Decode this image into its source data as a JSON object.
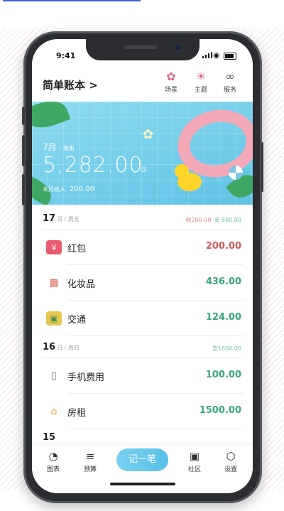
{
  "status": {
    "time": "9:41"
  },
  "header": {
    "title": "简单账本 >",
    "actions": [
      {
        "label": "场景",
        "icon": "scene-icon"
      },
      {
        "label": "主题",
        "icon": "theme-icon"
      },
      {
        "label": "服务",
        "icon": "service-icon"
      }
    ]
  },
  "banner": {
    "month": "7月",
    "month_sub": "· 支出",
    "expense": "5,282.00",
    "income_label": "本月收入",
    "income_value": "200.00"
  },
  "days": [
    {
      "date": "17",
      "weekday": "日 / 周五",
      "income": "收200.00",
      "expense": "支 580.00",
      "items": [
        {
          "name": "红包",
          "amount": "200.00",
          "icon": "red-envelope-icon",
          "type": "income"
        },
        {
          "name": "化妆品",
          "amount": "436.00",
          "icon": "lipstick-icon",
          "type": "expense"
        },
        {
          "name": "交通",
          "amount": "124.00",
          "icon": "bus-icon",
          "type": "expense"
        }
      ]
    },
    {
      "date": "16",
      "weekday": "日 / 周四",
      "income": "",
      "expense": "支1600.00",
      "items": [
        {
          "name": "手机费用",
          "amount": "100.00",
          "icon": "phone-icon",
          "type": "expense"
        },
        {
          "name": "房租",
          "amount": "1500.00",
          "icon": "house-icon",
          "type": "expense"
        }
      ]
    }
  ],
  "partial_day": {
    "date": "15"
  },
  "tabbar": {
    "left": [
      {
        "label": "图表"
      },
      {
        "label": "预算"
      }
    ],
    "center": "记一笔",
    "right": [
      {
        "label": "社区"
      },
      {
        "label": "设置"
      }
    ]
  },
  "colors": {
    "income": "#d15a5a",
    "expense": "#38a67a",
    "accent": "#5fc2e6"
  }
}
